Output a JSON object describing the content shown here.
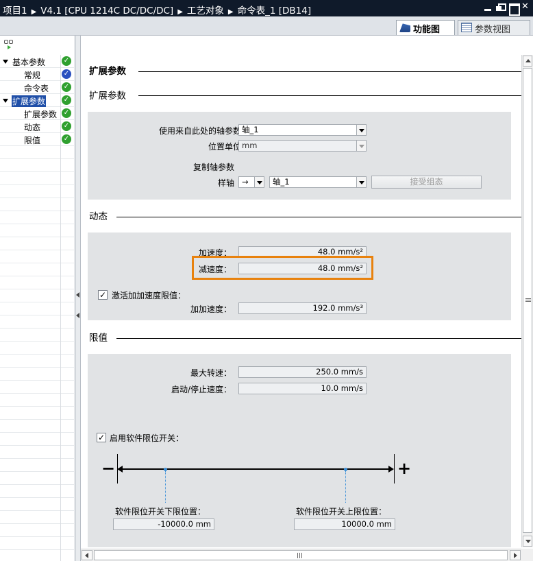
{
  "titlebar": {
    "crumbs": [
      "项目1",
      "V4.1 [CPU 1214C DC/DC/DC]",
      "工艺对象",
      "命令表_1 [DB14]"
    ],
    "close_glyph": "✕"
  },
  "tabs": {
    "function_view": "功能图",
    "param_view": "参数视图"
  },
  "nav": {
    "items": [
      {
        "label": "基本参数",
        "status": "ok"
      },
      {
        "label": "常规",
        "status": "ok-blue"
      },
      {
        "label": "命令表",
        "status": "ok"
      },
      {
        "label": "扩展参数",
        "status": "ok"
      },
      {
        "label": "扩展参数",
        "status": "ok"
      },
      {
        "label": "动态",
        "status": "ok"
      },
      {
        "label": "限值",
        "status": "ok"
      }
    ],
    "check_glyph": "✓"
  },
  "sections": {
    "main_title": "扩展参数",
    "ext_params": {
      "title": "扩展参数",
      "use_axis_label": "使用来自此处的轴参数",
      "use_axis_value": "轴_1",
      "pos_unit_label": "位置单位",
      "pos_unit_value": "mm",
      "copy_label": "复制轴参数",
      "sample_label": "样轴",
      "arrow_value": "→",
      "sample_value": "轴_1",
      "accept_button": "接受组态"
    },
    "dynamics": {
      "title": "动态",
      "accel_label": "加速度：",
      "accel_value": "48.0",
      "accel_unit": "mm/s²",
      "decel_label": "减速度：",
      "decel_value": "48.0",
      "decel_unit": "mm/s²",
      "jerk_check_label": "激活加加速度限值：",
      "jerk_checked": true,
      "jerk_label": "加加速度：",
      "jerk_value": "192.0",
      "jerk_unit": "mm/s³"
    },
    "limits": {
      "title": "限值",
      "max_speed_label": "最大转速：",
      "max_speed_value": "250.0",
      "max_speed_unit": "mm/s",
      "start_stop_label": "启动/停止速度：",
      "start_stop_value": "10.0",
      "start_stop_unit": "mm/s",
      "sw_limit_check_label": "启用软件限位开关：",
      "sw_limit_checked": true,
      "lower_label": "软件限位开关下限位置：",
      "lower_value": "-10000.0",
      "lower_unit": "mm",
      "upper_label": "软件限位开关上限位置：",
      "upper_value": "10000.0",
      "upper_unit": "mm",
      "minus_glyph": "−",
      "plus_glyph": "+"
    }
  },
  "colors": {
    "titlebar_bg": "#0f1a2a",
    "nav_selected": "#1f4fa8",
    "status_ok": "#2fa02f",
    "status_blue": "#2a4fbf",
    "highlight": "#e8820e"
  }
}
